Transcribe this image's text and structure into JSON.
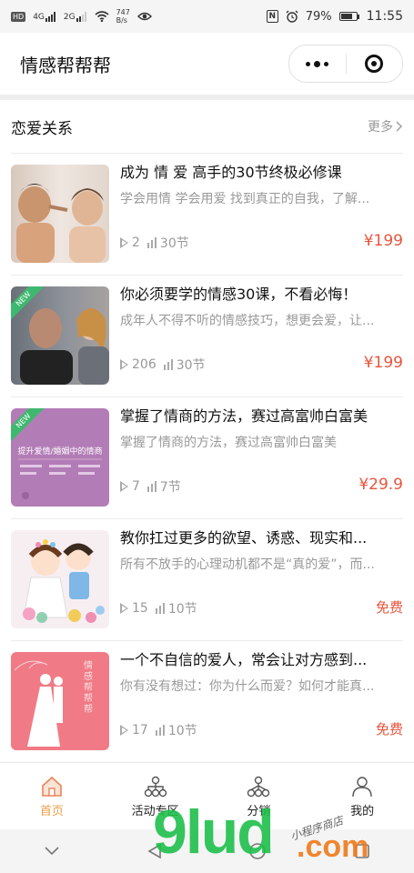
{
  "status_bar": {
    "hd": "HD",
    "net1": "4G",
    "net2": "2G",
    "speed_value": "747",
    "speed_unit": "B/s",
    "battery": "79%",
    "time": "11:55"
  },
  "nav": {
    "title": "情感帮帮帮"
  },
  "section": {
    "title": "恋爱关系",
    "more": "更多"
  },
  "courses": [
    {
      "title": "成为 情 爱 高手的30节终极必修课",
      "desc": "学会用情 学会用爱 找到真正的自我，了解...",
      "plays": "2",
      "lessons": "30节",
      "price": "¥199",
      "badge": ""
    },
    {
      "title": "你必须要学的情感30课，不看必悔！",
      "desc": "成年人不得不听的情感技巧，想更会爱，让...",
      "plays": "206",
      "lessons": "30节",
      "price": "¥199",
      "badge": "NEW"
    },
    {
      "title": "掌握了情商的方法，赛过高富帅白富美",
      "desc": "掌握了情商的方法，赛过高富帅白富美",
      "plays": "7",
      "lessons": "7节",
      "price": "¥29.9",
      "badge": "NEW",
      "thumb_text": "提升爱情/婚姻中的情商"
    },
    {
      "title": "教你扛过更多的欲望、诱惑、现实和...",
      "desc": "所有不放手的心理动机都不是“真的爱”，而...",
      "plays": "15",
      "lessons": "10节",
      "price": "免费",
      "badge": ""
    },
    {
      "title": "一个不自信的爱人，常会让对方感到...",
      "desc": "你有没有想过：你为什么而爱？如何才能真...",
      "plays": "17",
      "lessons": "10节",
      "price": "免费",
      "badge": "",
      "thumb_text": "情感帮帮帮"
    }
  ],
  "tabbar": [
    {
      "label": "首页",
      "icon": "home-icon"
    },
    {
      "label": "活动专区",
      "icon": "network-icon"
    },
    {
      "label": "分销",
      "icon": "share-tree-icon"
    },
    {
      "label": "我的",
      "icon": "user-icon"
    }
  ],
  "watermark": {
    "main": "9lud",
    "suffix": ".com",
    "handwriting": "小程序商店"
  },
  "colors": {
    "accent": "#e8a04a",
    "price": "#e8553d",
    "ribbon": "#3fb86f"
  }
}
